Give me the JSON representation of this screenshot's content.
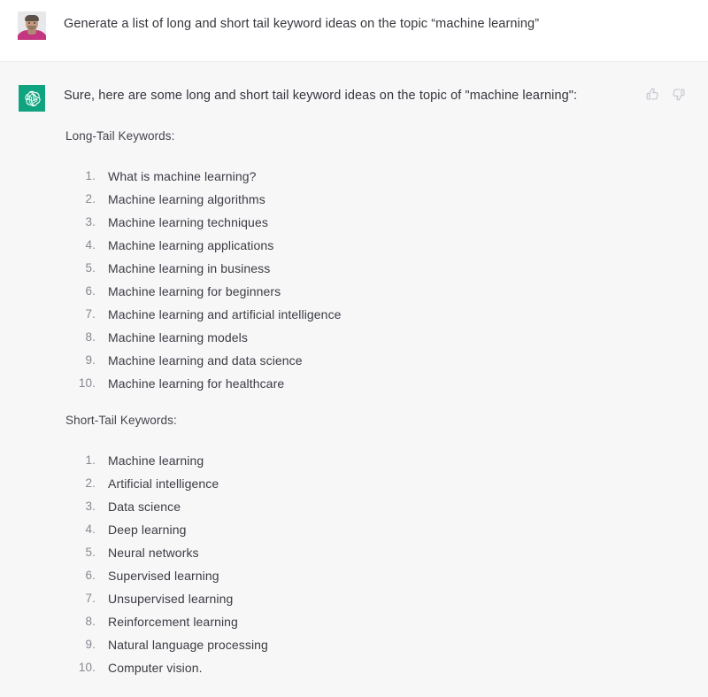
{
  "theme": {
    "user_bg": "#ffffff",
    "assistant_bg": "#f7f7f8",
    "divider": "#ececf1",
    "brand_green": "#10a37f",
    "text": "#35363c",
    "list_number": "#86878f"
  },
  "user_message": {
    "avatar_name": "user-avatar",
    "text": "Generate a list of long and short tail keyword ideas on the topic “machine learning”"
  },
  "assistant_message": {
    "avatar_name": "chatgpt-logo",
    "intro": "Sure, here are some long and short tail keyword ideas on the topic of \"machine learning\":",
    "feedback": {
      "thumbs_up_label": "thumbs-up",
      "thumbs_down_label": "thumbs-down"
    },
    "sections": [
      {
        "heading": "Long-Tail Keywords:",
        "items": [
          "What is machine learning?",
          "Machine learning algorithms",
          "Machine learning techniques",
          "Machine learning applications",
          "Machine learning in business",
          "Machine learning for beginners",
          "Machine learning and artificial intelligence",
          "Machine learning models",
          "Machine learning and data science",
          "Machine learning for healthcare"
        ]
      },
      {
        "heading": "Short-Tail Keywords:",
        "items": [
          "Machine learning",
          "Artificial intelligence",
          "Data science",
          "Deep learning",
          "Neural networks",
          "Supervised learning",
          "Unsupervised learning",
          "Reinforcement learning",
          "Natural language processing",
          "Computer vision."
        ]
      }
    ]
  }
}
